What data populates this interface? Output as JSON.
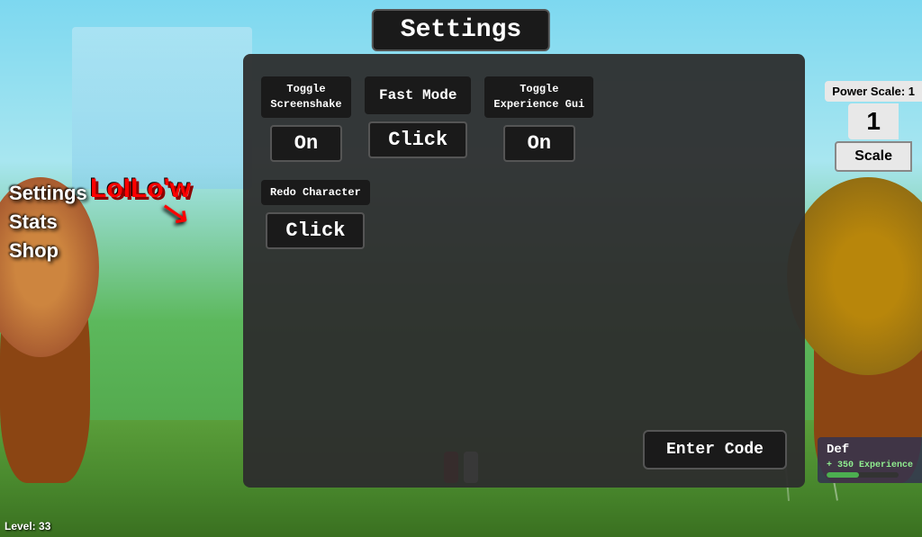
{
  "page": {
    "title": "Settings"
  },
  "sidebar": {
    "items": [
      {
        "label": "Settings"
      },
      {
        "label": "Stats"
      },
      {
        "label": "Shop"
      }
    ]
  },
  "powerScale": {
    "label": "Power Scale: 1",
    "value": "1",
    "scaleButton": "Scale"
  },
  "username": "LoILo'w",
  "level": "Level: 33",
  "defPanel": {
    "label": "Def",
    "expLabel": "+ 350 Experience"
  },
  "settings": {
    "rows": [
      {
        "items": [
          {
            "labelLine1": "Toggle",
            "labelLine2": "Screenshake",
            "value": "On"
          },
          {
            "labelLine1": "Fast Mode",
            "labelLine2": "",
            "value": "Click"
          },
          {
            "labelLine1": "Toggle",
            "labelLine2": "Experience Gui",
            "value": "On"
          }
        ]
      },
      {
        "items": [
          {
            "labelLine1": "Redo Character",
            "labelLine2": "",
            "value": "Click"
          }
        ]
      }
    ],
    "enterCodeButton": "Enter Code"
  }
}
